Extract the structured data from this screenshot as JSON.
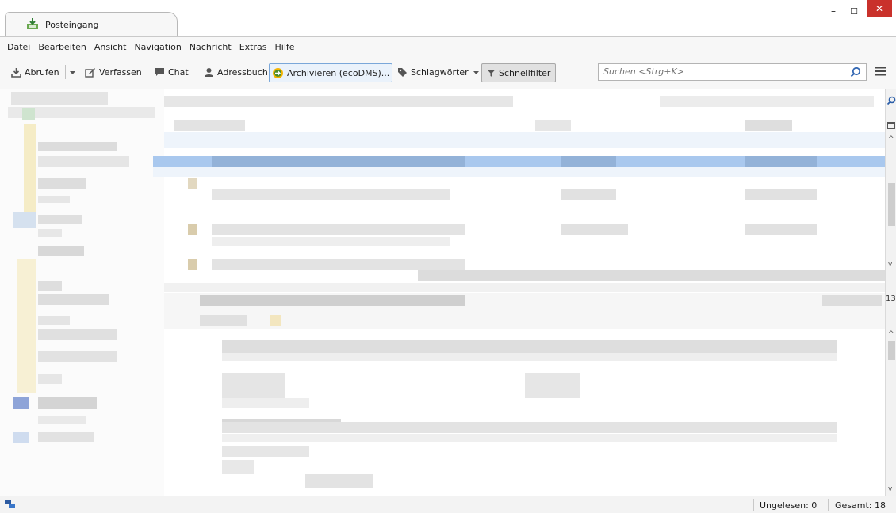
{
  "window": {
    "tab_title": "Posteingang",
    "controls": {
      "minimize": "–",
      "maximize": "☐",
      "close": "✕"
    }
  },
  "menubar": {
    "items": [
      {
        "pre": "",
        "key": "D",
        "post": "atei"
      },
      {
        "pre": "",
        "key": "B",
        "post": "earbeiten"
      },
      {
        "pre": "",
        "key": "A",
        "post": "nsicht"
      },
      {
        "pre": "Na",
        "key": "v",
        "post": "igation"
      },
      {
        "pre": "",
        "key": "N",
        "post": "achricht"
      },
      {
        "pre": "E",
        "key": "x",
        "post": "tras"
      },
      {
        "pre": "",
        "key": "H",
        "post": "ilfe"
      }
    ]
  },
  "toolbar": {
    "get_mail_label": "Abrufen",
    "compose_label": "Verfassen",
    "chat_label": "Chat",
    "addressbook_label": "Adressbuch",
    "archive_label": "Archivieren (ecoDMS)...",
    "tags_label": "Schlagwörter",
    "quickfilter_label": "Schnellfilter",
    "search_placeholder": "Suchen <Strg+K>"
  },
  "side_values": {
    "count": "13"
  },
  "statusbar": {
    "unread": "Ungelesen: 0",
    "total": "Gesamt: 18"
  },
  "colors": {
    "accent": "#d9262b",
    "selection": "#9cc1ec",
    "toolbar_bg": "#f7f7f7"
  }
}
